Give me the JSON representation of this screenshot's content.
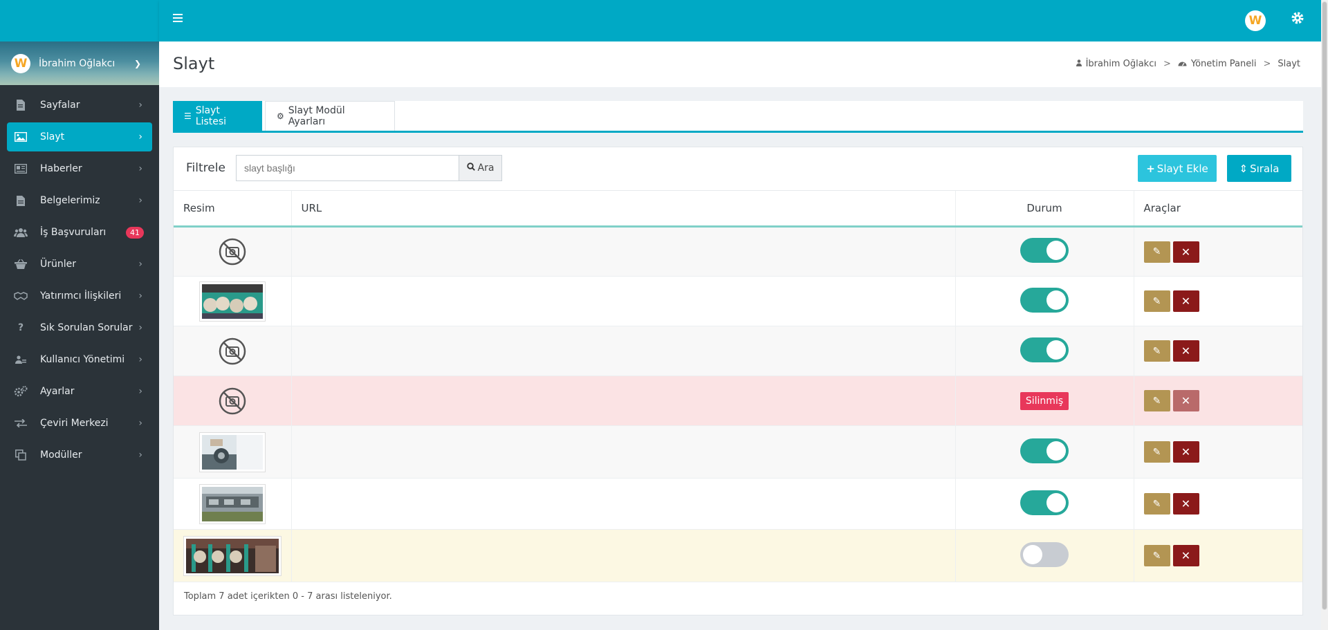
{
  "sidebar": {
    "user": {
      "avatar_letter": "W",
      "name": "İbrahim Oğlakcı"
    },
    "items": [
      {
        "label": "Sayfalar",
        "icon": "file-icon",
        "active": false
      },
      {
        "label": "Slayt",
        "icon": "image-icon",
        "active": true
      },
      {
        "label": "Haberler",
        "icon": "newspaper-icon",
        "active": false
      },
      {
        "label": "Belgelerimiz",
        "icon": "document-icon",
        "active": false
      },
      {
        "label": "İş Başvuruları",
        "icon": "users-icon",
        "active": false,
        "badge": "41"
      },
      {
        "label": "Ürünler",
        "icon": "basket-icon",
        "active": false
      },
      {
        "label": "Yatırımcı İlişkileri",
        "icon": "handshake-icon",
        "active": false
      },
      {
        "label": "Sık Sorulan Sorular",
        "icon": "question-icon",
        "active": false
      },
      {
        "label": "Kullanıcı Yönetimi",
        "icon": "user-cog-icon",
        "active": false
      },
      {
        "label": "Ayarlar",
        "icon": "gears-icon",
        "active": false
      },
      {
        "label": "Çeviri Merkezi",
        "icon": "exchange-icon",
        "active": false
      },
      {
        "label": "Modüller",
        "icon": "clone-icon",
        "active": false
      }
    ]
  },
  "topbar": {
    "avatar_letter": "W"
  },
  "page": {
    "title": "Slayt",
    "breadcrumb": [
      "İbrahim Oğlakcı",
      "Yönetim Paneli",
      "Slayt"
    ]
  },
  "tabs": [
    {
      "label": "Slayt Listesi",
      "icon": "list-icon",
      "active": true
    },
    {
      "label": "Slayt Modül Ayarları",
      "icon": "gear-icon",
      "active": false
    }
  ],
  "filter": {
    "label": "Filtrele",
    "search_placeholder": "slayt başlığı",
    "search_button": "Ara",
    "add_button": "Slayt Ekle",
    "sort_button": "Sırala"
  },
  "table": {
    "headers": [
      "Resim",
      "URL",
      "Durum",
      "Araçlar"
    ],
    "rows": [
      {
        "image": "none",
        "url": "",
        "status": "active"
      },
      {
        "image": "photo",
        "url": "",
        "status": "active"
      },
      {
        "image": "none",
        "url": "",
        "status": "active"
      },
      {
        "image": "none",
        "url": "",
        "status": "deleted",
        "status_label": "Silinmiş"
      },
      {
        "image": "photo",
        "url": "",
        "status": "active"
      },
      {
        "image": "photo",
        "url": "",
        "status": "active"
      },
      {
        "image": "photo",
        "url": "",
        "status": "passive"
      }
    ]
  },
  "footer": "Toplam 7 adet içerikten 0 - 7 arası listeleniyor.",
  "colors": {
    "accent": "#00a9c5",
    "sidebar_bg": "#2b3339",
    "toggle_on": "#26a89a",
    "deleted_badge": "#e8375a",
    "edit_btn": "#b39553",
    "delete_btn": "#8b1a1a"
  }
}
